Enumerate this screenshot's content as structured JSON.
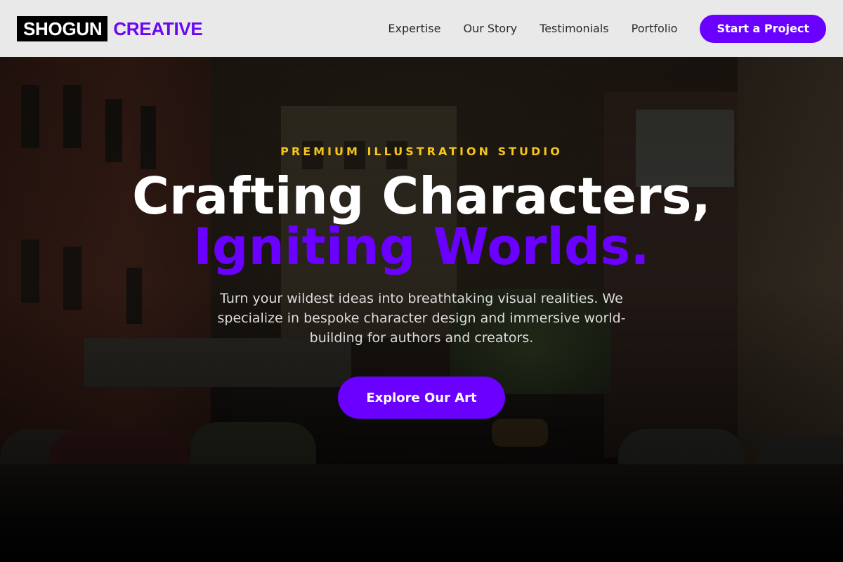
{
  "brand": {
    "name_part1": "SHOGUN",
    "name_part2": "CREATIVE"
  },
  "nav": {
    "items": [
      {
        "label": "Expertise"
      },
      {
        "label": "Our Story"
      },
      {
        "label": "Testimonials"
      },
      {
        "label": "Portfolio"
      }
    ],
    "cta_label": "Start a Project"
  },
  "hero": {
    "eyebrow": "PREMIUM ILLUSTRATION STUDIO",
    "title_line1": "Crafting Characters,",
    "title_line2": "Igniting Worlds.",
    "description": "Turn your wildest ideas into breathtaking visual realities. We specialize in bespoke character design and immersive world-building for authors and creators.",
    "cta_label": "Explore Our Art"
  },
  "colors": {
    "accent": "#6a00ff",
    "eyebrow": "#f5c518",
    "header_bg": "#e9e9e9"
  }
}
